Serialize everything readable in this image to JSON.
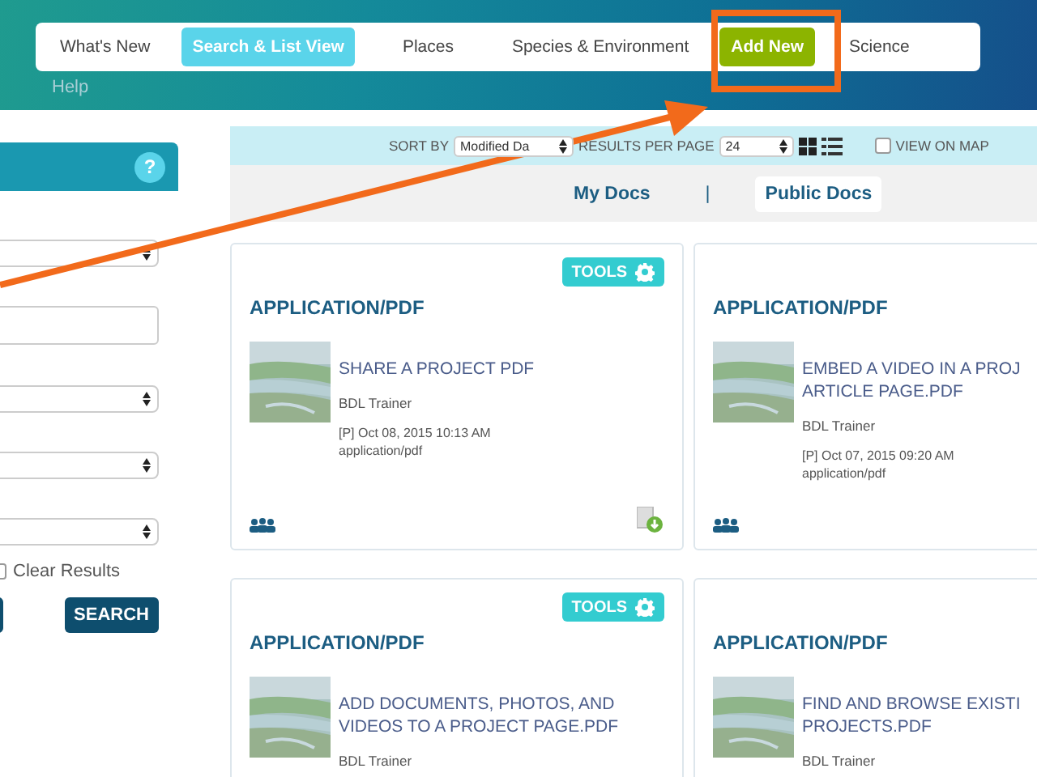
{
  "nav": {
    "items": [
      {
        "label": "What's New",
        "selected": false,
        "kind": "link"
      },
      {
        "label": "Search & List View",
        "selected": true,
        "kind": "link"
      },
      {
        "label": "Places",
        "selected": false,
        "kind": "link"
      },
      {
        "label": "Species & Environment",
        "selected": false,
        "kind": "link"
      },
      {
        "label": "Add New",
        "selected": false,
        "kind": "accent"
      },
      {
        "label": "Science",
        "selected": false,
        "kind": "link"
      }
    ],
    "help": "Help"
  },
  "filters": {
    "help_icon": "?",
    "fields": [
      {
        "kind": "select"
      },
      {
        "kind": "input"
      },
      {
        "kind": "select"
      },
      {
        "kind": "select"
      },
      {
        "kind": "select"
      }
    ],
    "clear_results": {
      "label": "Clear Results",
      "checked": false
    },
    "search_button": "SEARCH"
  },
  "toolbar": {
    "sort_label": "SORT BY",
    "sort_value": "Modified Da",
    "per_page_label": "RESULTS PER PAGE",
    "per_page_value": "24",
    "view_on_map": {
      "label": "VIEW ON MAP",
      "checked": false
    }
  },
  "doc_tabs": [
    {
      "label": "My Docs",
      "selected": false
    },
    {
      "label": "Public Docs",
      "selected": true
    }
  ],
  "doc_tab_separator": "|",
  "cards": [
    {
      "tools": "TOOLS",
      "type": "APPLICATION/PDF",
      "title": [
        "SHARE A PROJECT PDF"
      ],
      "author": "BDL Trainer",
      "date": "[P] Oct 08, 2015 10:13 AM",
      "mime": "application/pdf",
      "shared": true,
      "download": true
    },
    {
      "type": "APPLICATION/PDF",
      "title": [
        "EMBED A VIDEO IN A PROJ",
        "ARTICLE PAGE.PDF"
      ],
      "author": "BDL Trainer",
      "date": "[P] Oct 07, 2015 09:20 AM",
      "mime": "application/pdf",
      "shared": true
    },
    {
      "tools": "TOOLS",
      "type": "APPLICATION/PDF",
      "title": [
        "ADD DOCUMENTS, PHOTOS, AND",
        "VIDEOS TO A PROJECT PAGE.PDF"
      ],
      "author": "BDL Trainer"
    },
    {
      "type": "APPLICATION/PDF",
      "title": [
        "FIND AND BROWSE EXISTI",
        "PROJECTS.PDF"
      ],
      "author": "BDL Trainer"
    }
  ]
}
